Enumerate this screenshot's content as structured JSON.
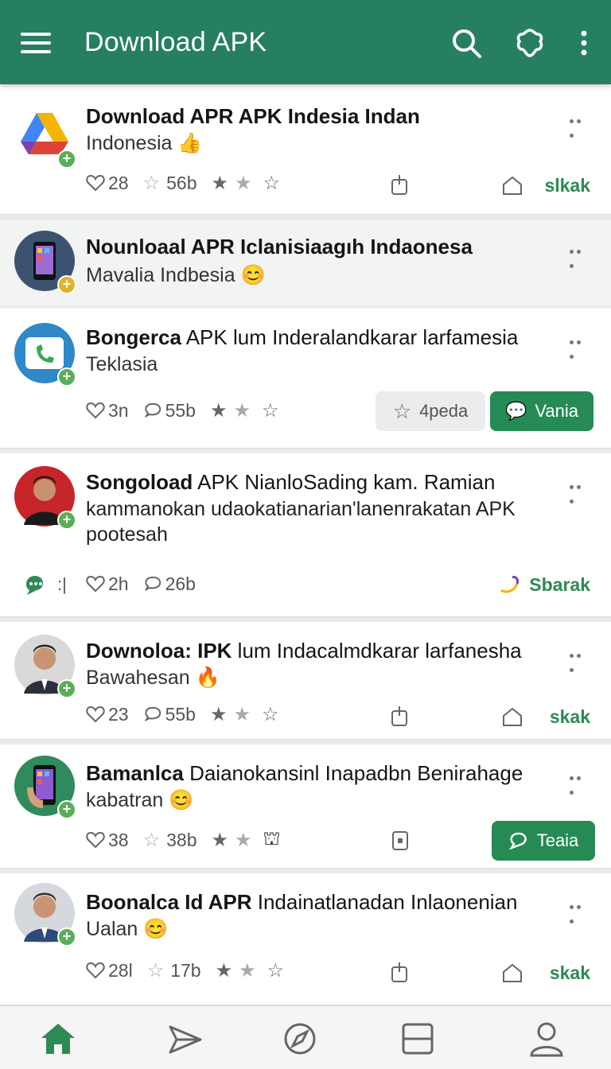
{
  "app_bar": {
    "title": "Download APK",
    "color": "#268060"
  },
  "posts": [
    {
      "title_bold": "Download APR APK Indesia Indan",
      "title_rest": "",
      "subtitle": "Indonesia",
      "emoji": "👍",
      "likes": "28",
      "stars": "56b",
      "action": "slkak"
    },
    {
      "title_bold": "Nounloaal APR Iclanisiaagıh Indaonesa",
      "title_rest": "",
      "subtitle": "Mavalia Indbesia",
      "emoji": "😊"
    },
    {
      "title_bold": "Bongerca",
      "title_rest": " APK lum Inderalandkarar larfamesia",
      "subtitle": "Teklasia",
      "likes": "3n",
      "comments": "55b",
      "btn_grey": "4peda",
      "btn_green": "Vania"
    },
    {
      "title_bold": "Songoload",
      "title_rest": " APK NianloSading kam. Ramian",
      "line2": "kammanokan udaokatianarian'lanenrakatan APK",
      "line3": "pootesah",
      "likes": "2h",
      "comments": "26b",
      "action": "Sbarak"
    },
    {
      "title_bold": "Downoloa: IPK",
      "title_rest": " lum Indacalmdkarar larfanesha",
      "subtitle": "Bawahesan",
      "emoji": "🔥",
      "likes": "23",
      "comments": "55b",
      "action": "skak"
    },
    {
      "title_bold": "Bamanlca",
      "title_rest": " Daianokansinl Inapadbn Benirahage",
      "subtitle": "kabatran",
      "emoji": "😊",
      "likes": "38",
      "stars": "38b",
      "btn_green": "Teaia"
    },
    {
      "title_bold": "Boonalca Id APR",
      "title_rest": " Indainatlanadan Inlaonenian",
      "subtitle": "Ualan",
      "emoji": "😊",
      "likes": "28l",
      "stars": "17b",
      "action": "skak"
    }
  ],
  "bottom_nav": [
    "home-icon",
    "share-icon",
    "compass-icon",
    "tab-icon",
    "profile-icon"
  ]
}
